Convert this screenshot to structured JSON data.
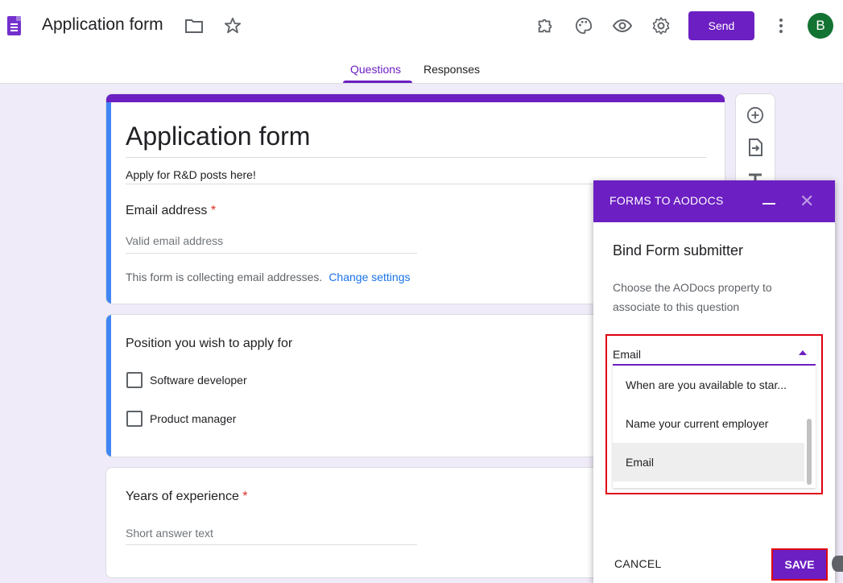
{
  "header": {
    "title": "Application form",
    "send_label": "Send",
    "avatar_initial": "B",
    "icons": [
      "folder-icon",
      "star-icon",
      "addon-icon",
      "palette-icon",
      "preview-icon",
      "settings-icon",
      "more-icon"
    ]
  },
  "tabs": {
    "questions": "Questions",
    "responses": "Responses"
  },
  "form": {
    "title": "Application form",
    "description": "Apply for R&D posts here!",
    "email_question": {
      "title": "Email address",
      "required_mark": "*",
      "placeholder": "Valid email address",
      "collecting_note": "This form is collecting email addresses.",
      "change_settings": "Change settings"
    },
    "position_question": {
      "title": "Position you wish to apply for",
      "options": [
        "Software developer",
        "Product manager"
      ]
    },
    "experience_question": {
      "title": "Years of experience",
      "required_mark": "*",
      "placeholder": "Short answer text"
    }
  },
  "dialog": {
    "header": "FORMS TO AODOCS",
    "title": "Bind Form submitter",
    "description": "Choose the AODocs property to associate to this question",
    "selected": "Email",
    "options": [
      "When are you available to star...",
      "Name your current employer",
      "Email"
    ],
    "cancel_label": "CANCEL",
    "save_label": "SAVE"
  },
  "colors": {
    "accent": "#6c1fc2",
    "highlight": "#e00012",
    "active_card": "#4285f4"
  }
}
